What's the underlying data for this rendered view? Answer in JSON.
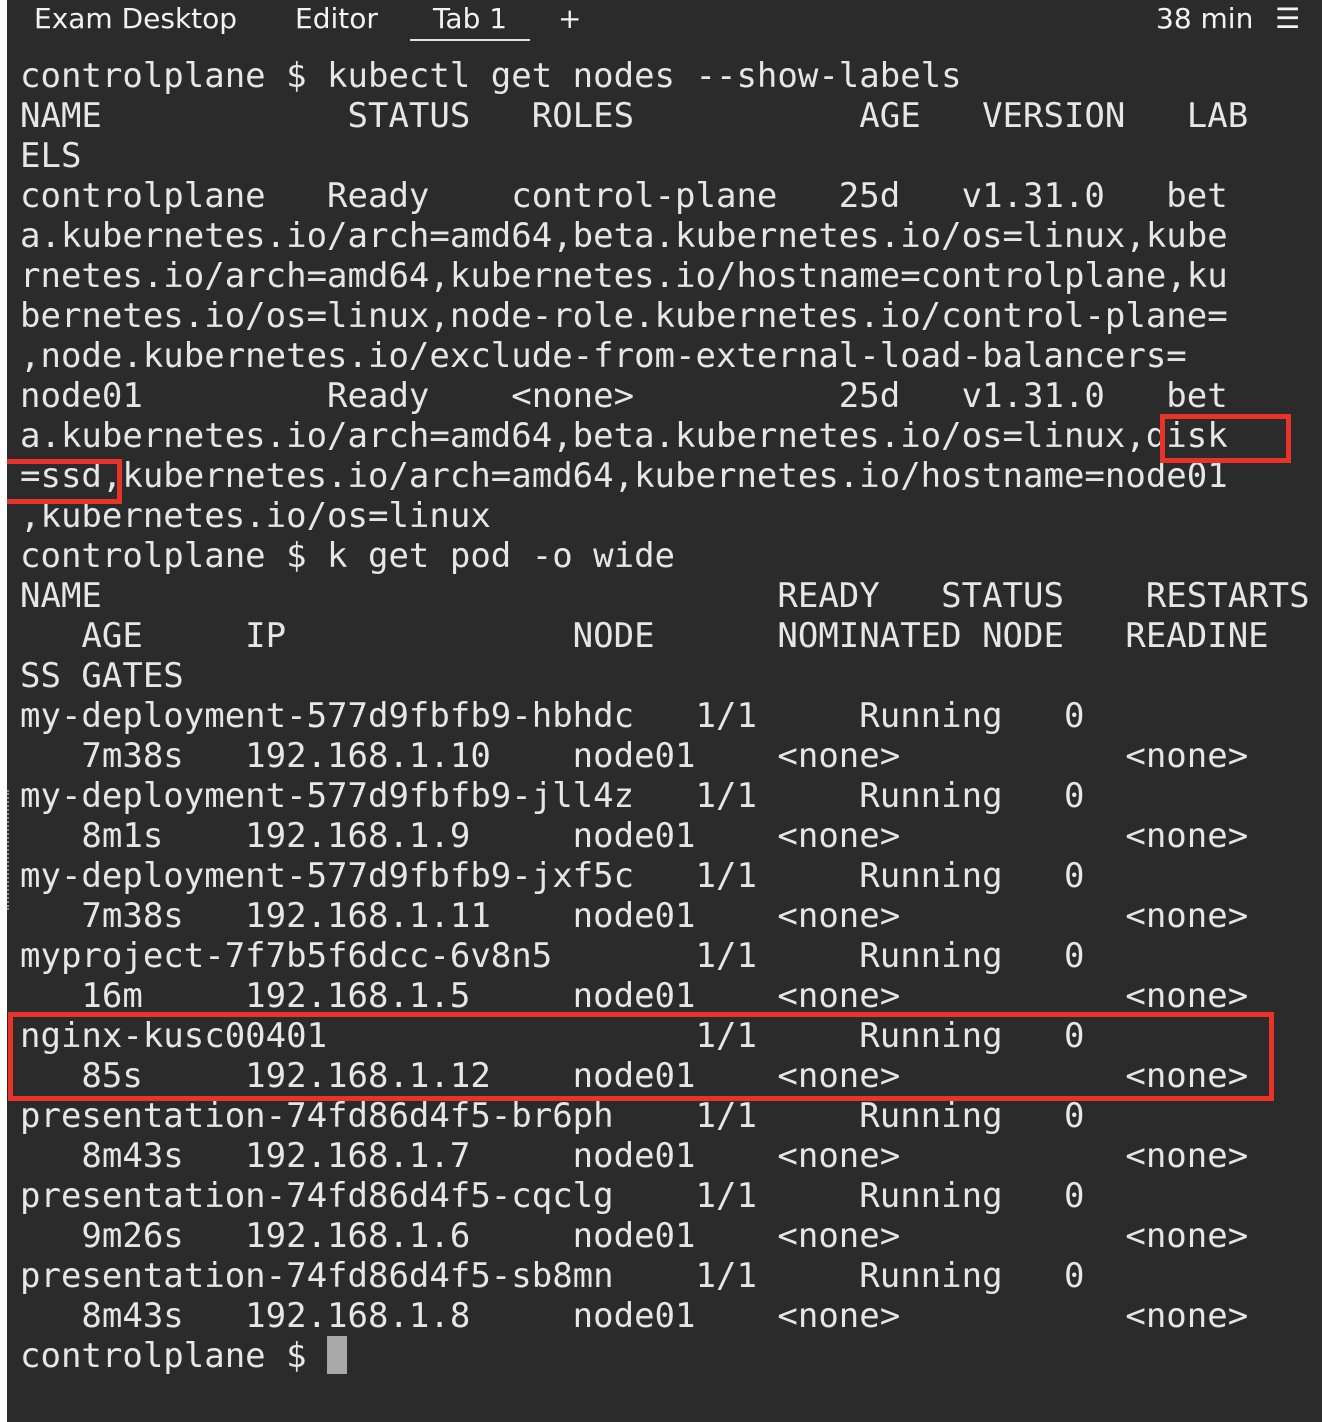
{
  "tabbar": {
    "tabs": [
      "Exam Desktop",
      "Editor",
      "Tab 1"
    ],
    "add_label": "+",
    "timer": "38 min",
    "menu_glyph": "☰"
  },
  "terminal": {
    "lines": [
      "controlplane $ kubectl get nodes --show-labels",
      "NAME            STATUS   ROLES           AGE   VERSION   LAB",
      "ELS",
      "controlplane   Ready    control-plane   25d   v1.31.0   bet",
      "a.kubernetes.io/arch=amd64,beta.kubernetes.io/os=linux,kube",
      "rnetes.io/arch=amd64,kubernetes.io/hostname=controlplane,ku",
      "bernetes.io/os=linux,node-role.kubernetes.io/control-plane=",
      ",node.kubernetes.io/exclude-from-external-load-balancers=",
      "node01         Ready    <none>          25d   v1.31.0   bet",
      "a.kubernetes.io/arch=amd64,beta.kubernetes.io/os=linux,disk",
      "=ssd,kubernetes.io/arch=amd64,kubernetes.io/hostname=node01",
      ",kubernetes.io/os=linux",
      "controlplane $ k get pod -o wide",
      "NAME                                 READY   STATUS    RESTARTS",
      "   AGE     IP              NODE      NOMINATED NODE   READINE",
      "SS GATES",
      "my-deployment-577d9fbfb9-hbhdc   1/1     Running   0",
      "   7m38s   192.168.1.10    node01    <none>           <none>",
      "my-deployment-577d9fbfb9-jll4z   1/1     Running   0",
      "   8m1s    192.168.1.9     node01    <none>           <none>",
      "my-deployment-577d9fbfb9-jxf5c   1/1     Running   0",
      "   7m38s   192.168.1.11    node01    <none>           <none>",
      "myproject-7f7b5f6dcc-6v8n5       1/1     Running   0",
      "   16m     192.168.1.5     node01    <none>           <none>",
      "nginx-kusc00401                  1/1     Running   0",
      "   85s     192.168.1.12    node01    <none>           <none>",
      "presentation-74fd86d4f5-br6ph    1/1     Running   0",
      "   8m43s   192.168.1.7     node01    <none>           <none>",
      "presentation-74fd86d4f5-cqclg    1/1     Running   0",
      "   9m26s   192.168.1.6     node01    <none>           <none>",
      "presentation-74fd86d4f5-sb8mn    1/1     Running   0",
      "   8m43s   192.168.1.8     node01    <none>           <none>"
    ],
    "prompt": "controlplane $ "
  },
  "colors": {
    "background": "#2b2b2b",
    "text": "#e6e6e6",
    "highlight": "#e8322a"
  }
}
